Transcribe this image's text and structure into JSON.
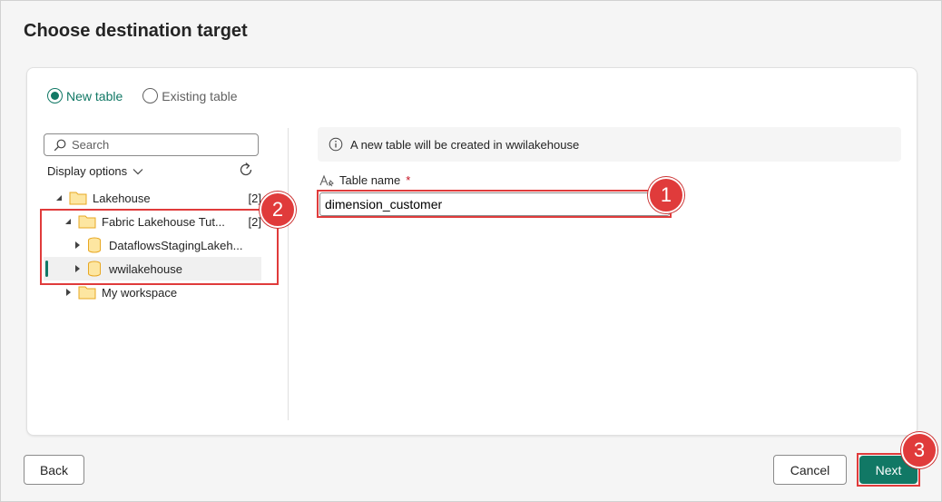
{
  "dialog": {
    "title": "Choose destination target"
  },
  "radios": [
    {
      "label": "New table",
      "checked": true
    },
    {
      "label": "Existing table",
      "checked": false
    }
  ],
  "search": {
    "placeholder": "Search"
  },
  "display_options": {
    "label": "Display options"
  },
  "tree": [
    {
      "label": "Lakehouse",
      "count": "[2]",
      "type": "folder",
      "expanded": true,
      "level": 0
    },
    {
      "label": "Fabric Lakehouse Tut...",
      "count": "[2]",
      "type": "folder",
      "expanded": true,
      "level": 1
    },
    {
      "label": "DataflowsStagingLakeh...",
      "count": "",
      "type": "lakehouse",
      "expanded": false,
      "level": 2
    },
    {
      "label": "wwilakehouse",
      "count": "",
      "type": "lakehouse",
      "expanded": false,
      "level": 2,
      "selected": true
    },
    {
      "label": "My workspace",
      "count": "",
      "type": "folder",
      "expanded": false,
      "level": 1
    }
  ],
  "info": {
    "message": "A new table will be created in wwilakehouse"
  },
  "table_name": {
    "label": "Table name",
    "required_mark": "*",
    "value": "dimension_customer"
  },
  "annotations": {
    "badge1": "1",
    "badge2": "2",
    "badge3": "3"
  },
  "footer": {
    "back_label": "Back",
    "cancel_label": "Cancel",
    "next_label": "Next"
  },
  "colors": {
    "accent": "#117865",
    "highlight": "#e03b3b",
    "folder": "#f5c542"
  }
}
